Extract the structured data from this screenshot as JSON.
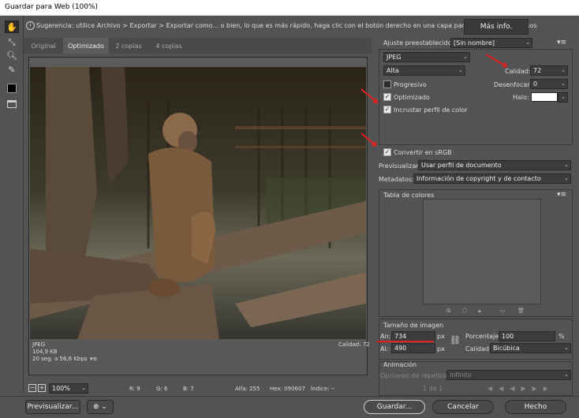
{
  "window": {
    "title": "Guardar para Web (100%)"
  },
  "hint": {
    "text": "Sugerencia: utilice Archivo > Exportar > Exportar como... o bien, lo que es más rápido, haga clic con el botón derecho en una capa para exportar los recursos",
    "more_button": "Más info."
  },
  "tabs": [
    {
      "label": "Original"
    },
    {
      "label": "Optimizado"
    },
    {
      "label": "2 copias"
    },
    {
      "label": "4 copias"
    }
  ],
  "preview": {
    "format": "JPEG",
    "size": "104,9 KB",
    "timing": "20 seg. a 56,6 Kbps",
    "quality": "Calidad: 72"
  },
  "statusbar": {
    "zoom": "100%",
    "r": "R: 9",
    "g": "G: 6",
    "b": "B: 7",
    "alpha": "Alfa: 255",
    "hex": "Hex: 090607",
    "index": "Índice: --"
  },
  "settings": {
    "preset_label": "Ajuste preestablecido:",
    "preset_value": "[Sin nombre]",
    "format": "JPEG",
    "quality_level": "Alta",
    "quality_label": "Calidad:",
    "quality_value": "72",
    "progressive_label": "Progresivo",
    "progressive_checked": false,
    "blur_label": "Desenfocar:",
    "blur_value": "0",
    "optimized_label": "Optimizado",
    "optimized_checked": true,
    "matte_label": "Halo:",
    "embed_label": "Incrustar perfil de color",
    "embed_checked": true,
    "srgb_label": "Convertir en sRGB",
    "srgb_checked": true,
    "preview_label": "Previsualizar:",
    "preview_value": "Usar perfil de documento",
    "metadata_label": "Metadatos:",
    "metadata_value": "Información de copyright y de contacto"
  },
  "color_table": {
    "title": "Tabla de colores"
  },
  "image_size": {
    "title": "Tamaño de imagen",
    "width_label": "An:",
    "width_value": "734",
    "width_unit": "px",
    "height_label": "Al:",
    "height_value": "490",
    "height_unit": "px",
    "percent_label": "Porcentaje:",
    "percent_value": "100",
    "percent_unit": "%",
    "quality_label": "Calidad:",
    "quality_value": "Bicúbica"
  },
  "animation": {
    "title": "Animación",
    "loop_label": "Opciones de repetición:",
    "loop_value": "Infinito",
    "frame": "1 de 1"
  },
  "buttons": {
    "preview": "Previsualizar...",
    "save": "Guardar...",
    "cancel": "Cancelar",
    "done": "Hecho"
  },
  "colors": {
    "accent_red": "#e02020",
    "panel": "#535353"
  }
}
